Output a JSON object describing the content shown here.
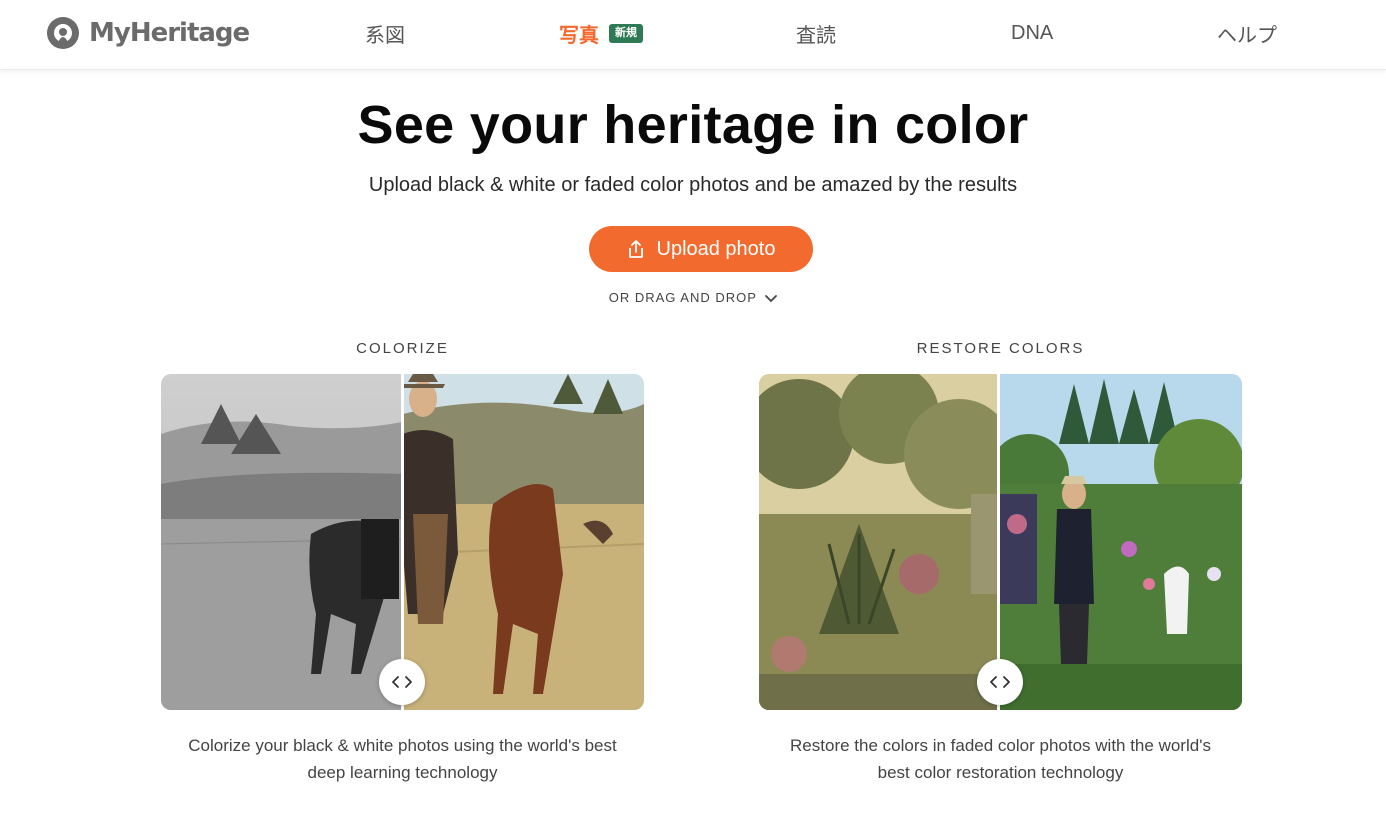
{
  "brand": {
    "name": "MyHeritage"
  },
  "nav": {
    "items": [
      {
        "label": "系図"
      },
      {
        "label": "写真",
        "badge": "新規",
        "active": true
      },
      {
        "label": "査読"
      },
      {
        "label": "DNA"
      },
      {
        "label": "ヘルプ"
      }
    ]
  },
  "hero": {
    "title": "See your heritage in color",
    "subtitle": "Upload black & white or faded color photos and be amazed by the results",
    "upload_label": "Upload photo",
    "drag_label": "OR DRAG AND DROP"
  },
  "sections": [
    {
      "label": "COLORIZE",
      "caption_line1": "Colorize your black & white photos using the world's best",
      "caption_line2": "deep learning technology"
    },
    {
      "label": "RESTORE COLORS",
      "caption_line1": "Restore the colors in faded color photos with the world's",
      "caption_line2": "best color restoration technology"
    }
  ],
  "colors": {
    "accent": "#f26a2e",
    "badge": "#2f7a55",
    "logo": "#6b6b6b"
  },
  "icons": [
    "myheritage-logo-icon",
    "upload-icon",
    "chevron-down-icon",
    "compare-arrows-icon"
  ]
}
